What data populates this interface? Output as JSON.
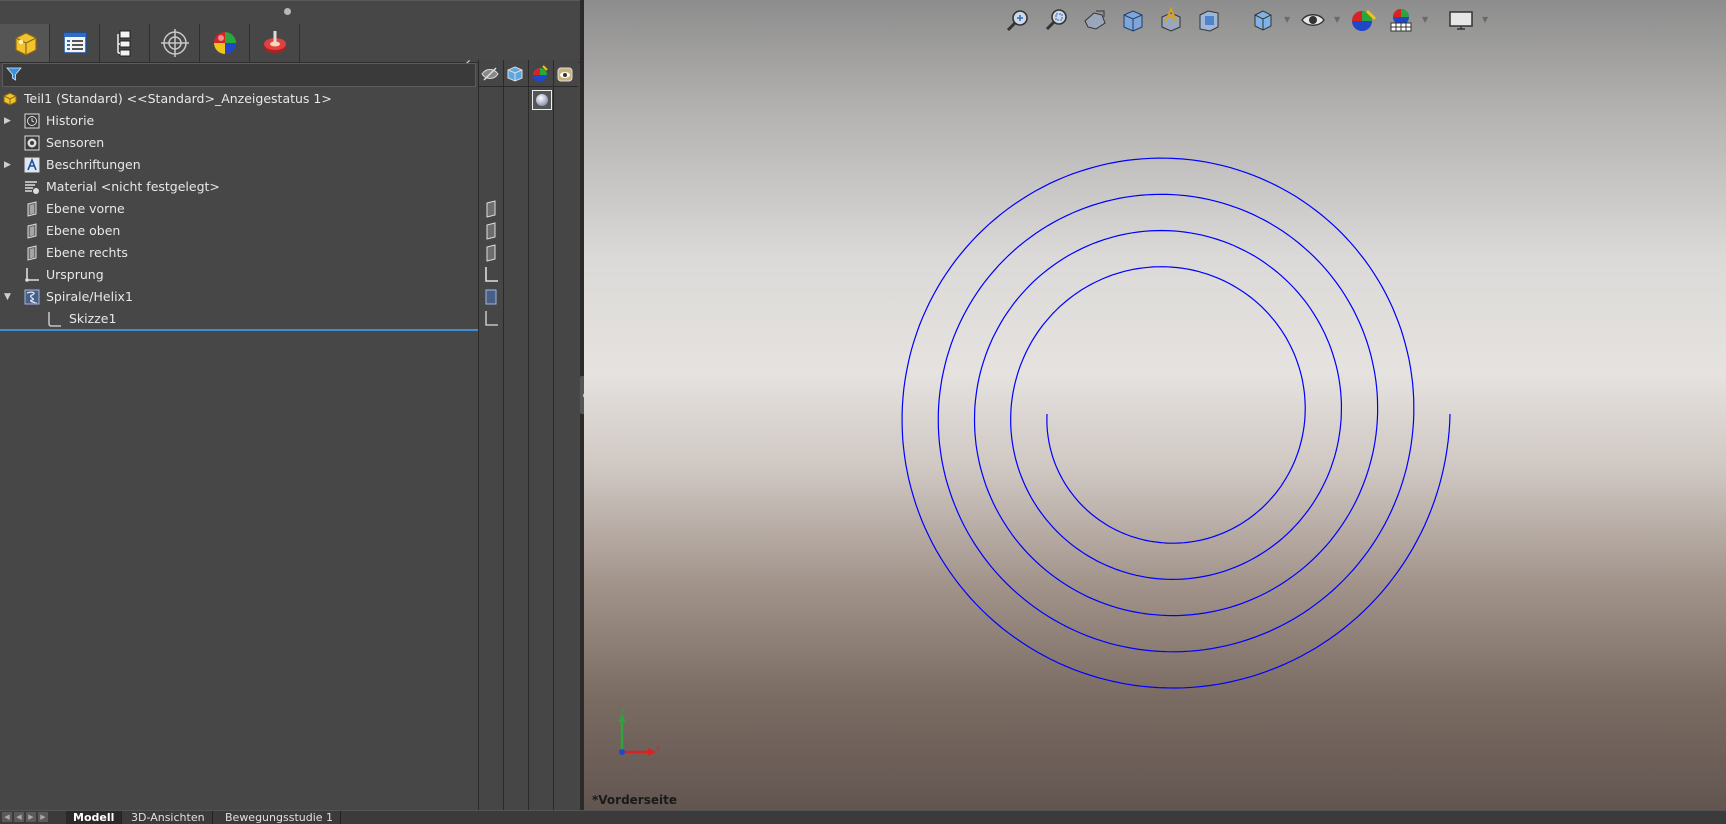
{
  "feature_tree": {
    "root_label": "Teil1 (Standard) <<Standard>_Anzeigestatus 1>",
    "items": [
      {
        "label": "Historie",
        "expander": "▶",
        "icon": "history-icon"
      },
      {
        "label": "Sensoren",
        "expander": "",
        "icon": "sensor-icon"
      },
      {
        "label": "Beschriftungen",
        "expander": "▶",
        "icon": "annotations-icon"
      },
      {
        "label": "Material <nicht festgelegt>",
        "expander": "",
        "icon": "material-icon"
      },
      {
        "label": "Ebene vorne",
        "expander": "",
        "icon": "plane-icon"
      },
      {
        "label": "Ebene oben",
        "expander": "",
        "icon": "plane-icon"
      },
      {
        "label": "Ebene rechts",
        "expander": "",
        "icon": "plane-icon"
      },
      {
        "label": "Ursprung",
        "expander": "",
        "icon": "origin-icon"
      },
      {
        "label": "Spirale/Helix1",
        "expander": "▼",
        "icon": "helix-icon"
      },
      {
        "label": "Skizze1",
        "expander": "",
        "icon": "sketch-icon"
      }
    ]
  },
  "panel_tabs": [
    {
      "name": "featuremanager-tab",
      "icon": "part-icon"
    },
    {
      "name": "propertymanager-tab",
      "icon": "property-list-icon"
    },
    {
      "name": "configurationmanager-tab",
      "icon": "configuration-tree-icon"
    },
    {
      "name": "dimxpertmanager-tab",
      "icon": "target-icon"
    },
    {
      "name": "displaymanager-tab",
      "icon": "appearance-sphere-icon"
    },
    {
      "name": "cam-tab",
      "icon": "cam-icon"
    }
  ],
  "view_toolbar": [
    "zoom-to-fit-icon",
    "zoom-to-area-icon",
    "previous-view-icon",
    "section-view-icon",
    "dynamic-annotation-view-icon",
    "view-orientation-icon",
    "display-style-icon",
    "hide-show-items-icon",
    "edit-appearance-icon",
    "apply-scene-icon",
    "view-settings-icon"
  ],
  "viewport": {
    "view_label": "*Vorderseite",
    "curve_color": "#0000ff"
  },
  "bottom_tabs": [
    "Modell",
    "3D-Ansichten",
    "Bewegungsstudie 1"
  ],
  "colors": {
    "panel_bg": "#474747",
    "selection_line": "#3d8fd6",
    "tree_text": "#e8e8e8"
  }
}
